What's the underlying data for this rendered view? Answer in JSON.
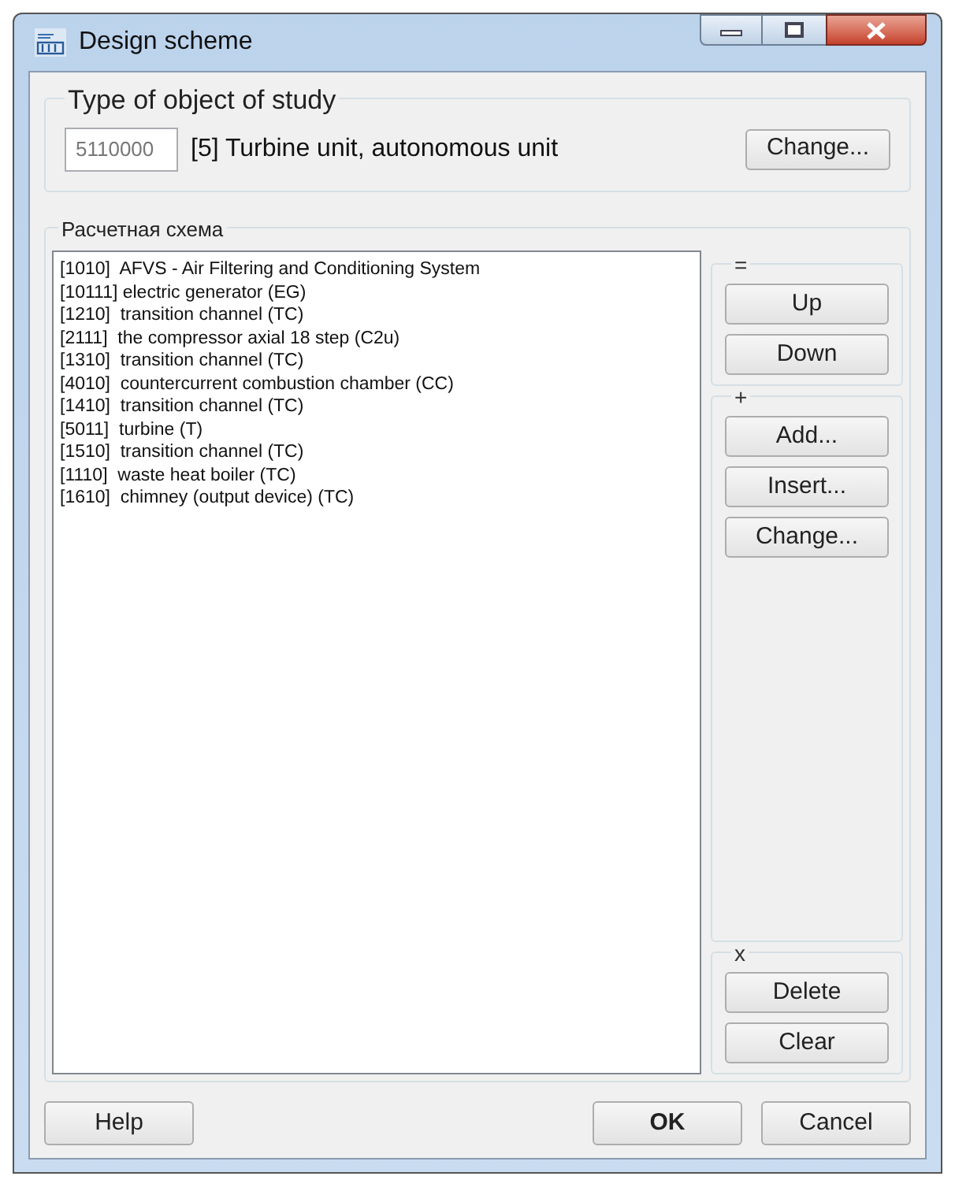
{
  "window": {
    "title": "Design scheme"
  },
  "object_type": {
    "legend": "Type of object of study",
    "code": "5110000",
    "description": "[5] Turbine unit, autonomous unit",
    "button": "Change..."
  },
  "scheme": {
    "legend": "Расчетная схема",
    "items": [
      "[1010]  AFVS - Air Filtering and Conditioning System",
      "[10111] electric generator (EG)",
      "[1210]  transition channel (TC)",
      "[2111]  the compressor axial 18 step (C2u)",
      "[1310]  transition channel (TC)",
      "[4010]  countercurrent combustion chamber (CC)",
      "[1410]  transition channel (TC)",
      "[5011]  turbine (T)",
      "[1510]  transition channel (TC)",
      "[1110]  waste heat boiler (TC)",
      "[1610]  chimney (output device) (TC)"
    ],
    "groups": [
      {
        "mark": "=",
        "kind": "top",
        "buttons": [
          "Up",
          "Down"
        ]
      },
      {
        "mark": "+",
        "kind": "fill",
        "buttons": [
          "Add...",
          "Insert...",
          "Change..."
        ]
      },
      {
        "mark": "x",
        "kind": "bottom",
        "buttons": [
          "Delete",
          "Clear"
        ]
      }
    ]
  },
  "footer": {
    "buttons": [
      {
        "label": "Help",
        "default": false
      },
      {
        "label": "OK",
        "default": true
      },
      {
        "label": "Cancel",
        "default": false
      }
    ]
  }
}
